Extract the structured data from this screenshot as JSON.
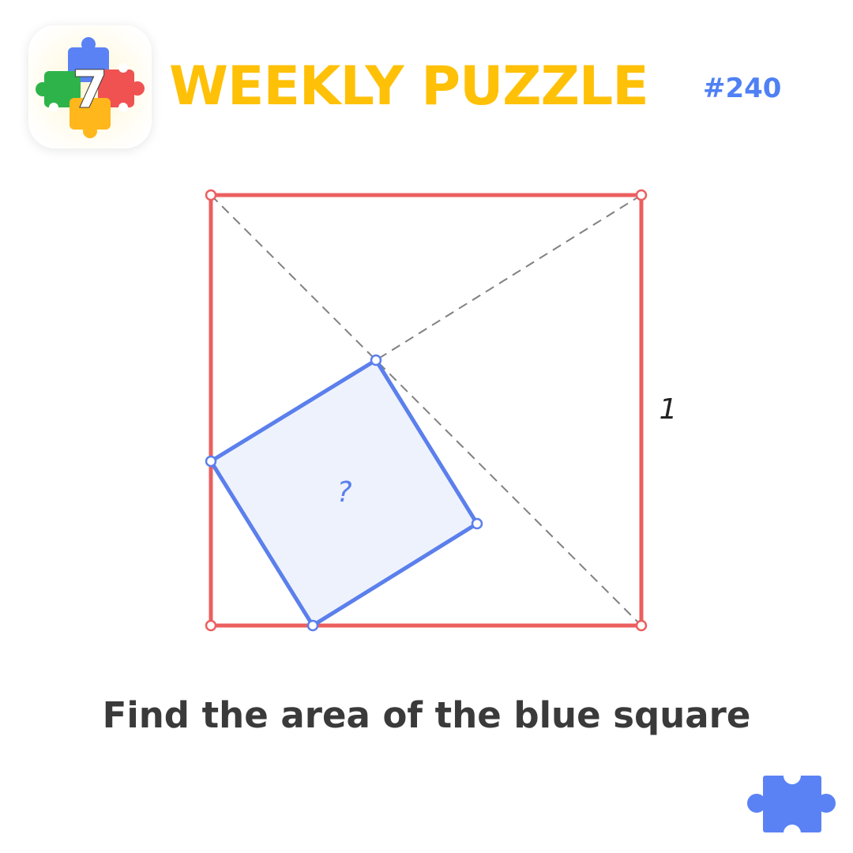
{
  "header": {
    "logo_number": "7",
    "title": "WEEKLY PUZZLE",
    "puzzle_number": "#240"
  },
  "diagram": {
    "outer_square_side_label": "1",
    "blue_square_label": "?"
  },
  "question": "Find the area of the blue square",
  "icons": {
    "logo": "puzzle-pieces-logo-icon",
    "corner": "puzzle-piece-icon"
  },
  "colors": {
    "title": "#FFC107",
    "puzzle_number": "#4F80F4",
    "outer_square": "#EC5F5F",
    "blue_square_stroke": "#5B7FEC",
    "blue_square_fill": "#EEF2FD",
    "dashed_lines": "#808080",
    "question_text": "#3A3A3A",
    "corner_piece": "#5B82F5",
    "logo_green": "#2EB34A",
    "logo_red": "#F05252",
    "logo_blue": "#5B82F5",
    "logo_yellow": "#FFB71B"
  }
}
